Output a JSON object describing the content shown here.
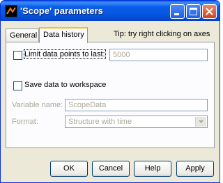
{
  "window": {
    "title": "'Scope' parameters"
  },
  "tabs": [
    {
      "label": "General",
      "selected": false
    },
    {
      "label": "Data history",
      "selected": true
    }
  ],
  "tip": "Tip: try right clicking on axes",
  "limit_points": {
    "label": "Limit data points to last:",
    "checked": false,
    "value": "5000"
  },
  "save_workspace": {
    "label": "Save data to workspace",
    "checked": false
  },
  "variable": {
    "label": "Variable name:",
    "value": "ScopeData"
  },
  "format": {
    "label": "Format:",
    "value": "Structure with time"
  },
  "buttons": {
    "ok": "OK",
    "cancel": "Cancel",
    "help": "Help",
    "apply": "Apply"
  },
  "colors": {
    "title_bar": "#0a5ee9",
    "close_button": "#c9471f",
    "dialog_bg": "#ece9d8",
    "disabled_text": "#aca899"
  }
}
